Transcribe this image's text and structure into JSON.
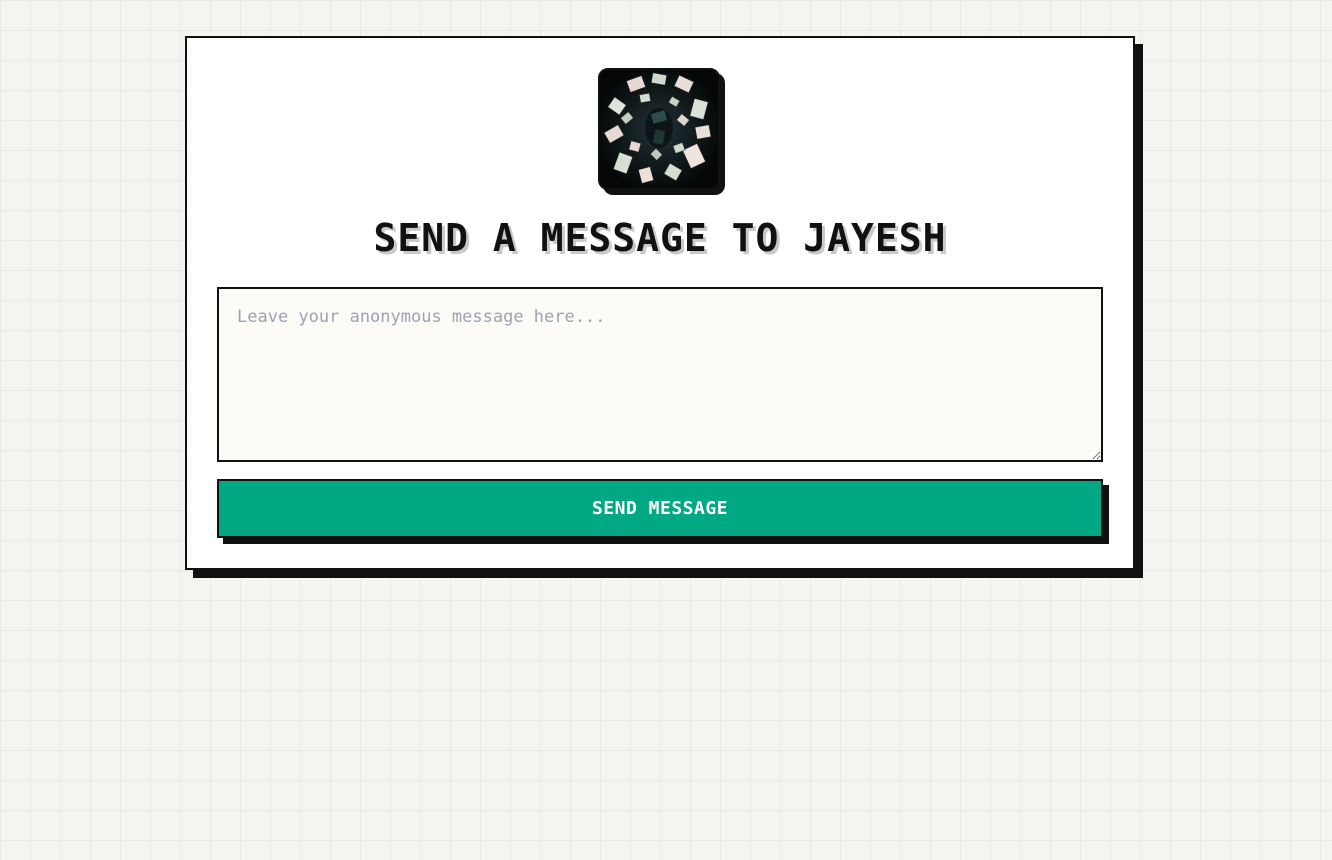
{
  "profile": {
    "avatar_alt": "avatar"
  },
  "heading": {
    "title": "SEND A MESSAGE TO JAYESH"
  },
  "form": {
    "message_value": "",
    "message_placeholder": "Leave your anonymous message here...",
    "send_label": "SEND MESSAGE"
  },
  "colors": {
    "background": "#f5f4f0",
    "card": "#ffffff",
    "border": "#111111",
    "accent": "#00a884",
    "textarea_bg": "#fcfbf7",
    "placeholder": "#9aa3b2"
  }
}
